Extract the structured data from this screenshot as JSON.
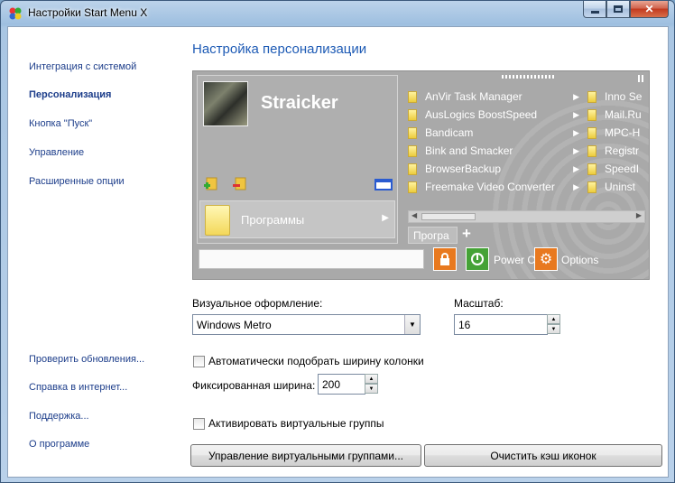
{
  "window": {
    "title": "Настройки Start Menu X",
    "minimize_icon": "minimize-icon",
    "maximize_icon": "maximize-icon",
    "close_icon": "close-icon",
    "close_glyph": "✕"
  },
  "sidebar": {
    "items": [
      {
        "label": "Интеграция с системой"
      },
      {
        "label": "Персонализация"
      },
      {
        "label": "Кнопка \"Пуск\""
      },
      {
        "label": "Управление"
      },
      {
        "label": "Расширенные опции"
      }
    ],
    "bottom_links": [
      {
        "label": "Проверить обновления..."
      },
      {
        "label": "Справка в интернет..."
      },
      {
        "label": "Поддержка..."
      },
      {
        "label": "О программе"
      }
    ]
  },
  "main": {
    "heading": "Настройка персонализации",
    "preview": {
      "username": "Straicker",
      "programs_label": "Программы",
      "tab_label": "Програ",
      "tab_plus": "+",
      "power_label": "Power C",
      "options_label": "Options",
      "menu_col1": [
        "AnVir Task Manager",
        "AusLogics BoostSpeed",
        "Bandicam",
        "Bink and Smacker",
        "BrowserBackup",
        "Freemake Video Converter"
      ],
      "menu_col2": [
        "Inno Se",
        "Mail.Ru",
        "MPC-H",
        "Registr",
        "SpeedI",
        "Uninst"
      ]
    },
    "visual_style": {
      "label": "Визуальное оформление:",
      "value": "Windows Metro"
    },
    "scale": {
      "label": "Масштаб:",
      "value": "16"
    },
    "auto_width": {
      "label": "Автоматически подобрать ширину колонки"
    },
    "fixed_width": {
      "label": "Фиксированная ширина:",
      "value": "200"
    },
    "virtual_groups": {
      "label": "Активировать виртуальные группы"
    },
    "buttons": {
      "manage_groups": "Управление виртуальными группами...",
      "clear_cache": "Очистить кэш иконок"
    }
  },
  "colors": {
    "accent": "#1e5bb5",
    "link": "#1c3d8a",
    "preview_bg": "#a9a9a9",
    "lock_btn": "#e8791f",
    "power_btn": "#45a236"
  }
}
